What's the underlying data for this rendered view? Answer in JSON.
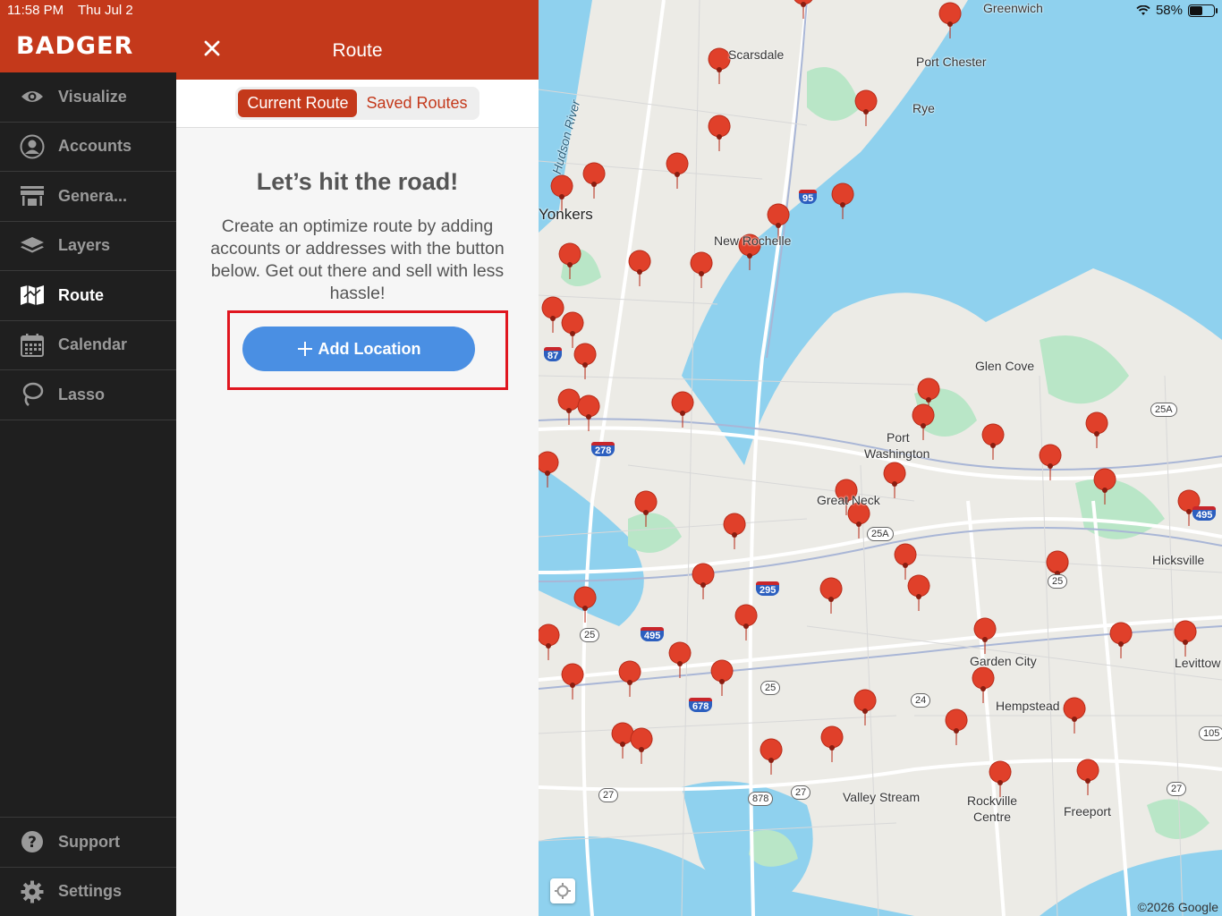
{
  "status": {
    "time": "11:58 PM",
    "date": "Thu Jul 2",
    "battery": "58%"
  },
  "brand": {
    "logo_text": "BADGER",
    "color": "#c4391b"
  },
  "sidebar": {
    "items": [
      {
        "label": "Visualize",
        "icon": "eye-icon"
      },
      {
        "label": "Accounts",
        "icon": "user-circle-icon"
      },
      {
        "label": "Genera...",
        "icon": "store-icon"
      },
      {
        "label": "Layers",
        "icon": "layers-icon"
      },
      {
        "label": "Route",
        "icon": "map-icon",
        "active": true
      },
      {
        "label": "Calendar",
        "icon": "calendar-icon"
      },
      {
        "label": "Lasso",
        "icon": "lasso-icon"
      }
    ],
    "bottom": [
      {
        "label": "Support",
        "icon": "help-icon"
      },
      {
        "label": "Settings",
        "icon": "gear-icon"
      }
    ]
  },
  "panel": {
    "title": "Route",
    "tabs": [
      {
        "label": "Current Route",
        "active": true
      },
      {
        "label": "Saved Routes",
        "active": false
      }
    ],
    "heading": "Let’s hit the road!",
    "body": "Create an optimize route by adding accounts or addresses with the button below. Get out there and sell with less hassle!",
    "cta": "Add Location",
    "cta_color": "#4a8fe3"
  },
  "map": {
    "labels": {
      "greenwich": "Greenwich",
      "scarsdale": "Scarsdale",
      "port_chester": "Port Chester",
      "rye": "Rye",
      "yonkers": "Yonkers",
      "new_rochelle": "New Rochelle",
      "glen_cove": "Glen Cove",
      "port_washington_1": "Port",
      "port_washington_2": "Washington",
      "great_neck": "Great Neck",
      "hicksville": "Hicksville",
      "garden_city": "Garden City",
      "levittown": "Levittow",
      "hempstead": "Hempstead",
      "valley_stream": "Valley Stream",
      "rockville_1": "Rockville",
      "rockville_2": "Centre",
      "freeport": "Freeport",
      "hudson_river": "Hudson River"
    },
    "shields": {
      "i95": "95",
      "i87": "87",
      "i278": "278",
      "i295": "295",
      "i495a": "495",
      "i495b": "495",
      "i678": "678",
      "r25a1": "25A",
      "r25a2": "25A",
      "r25a": "25",
      "r25b": "25",
      "r25c": "25",
      "r24": "24",
      "r27a": "27",
      "r27b": "27",
      "r27c": "27",
      "r878": "878",
      "r105": "105"
    },
    "copyright": "©2026 Google",
    "pin_color": "#e0402a"
  }
}
